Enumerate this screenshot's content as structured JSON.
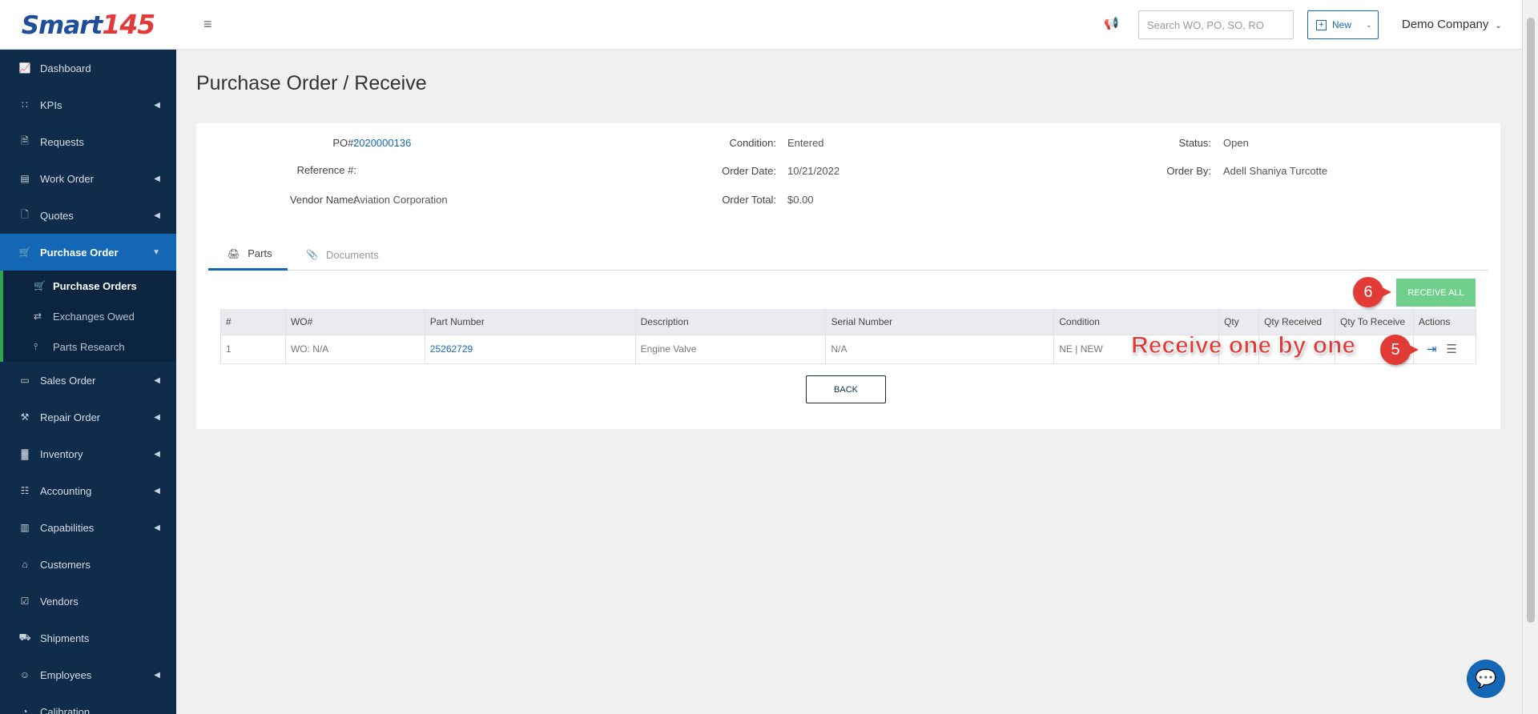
{
  "app": {
    "logo_text": "Smart",
    "logo_num": "145"
  },
  "sidebar": {
    "items": [
      {
        "label": "Dashboard",
        "icon": "chart-icon",
        "chevron": false
      },
      {
        "label": "KPIs",
        "icon": "kpi-icon",
        "chevron": true
      },
      {
        "label": "Requests",
        "icon": "document-icon",
        "chevron": false
      },
      {
        "label": "Work Order",
        "icon": "work-order-icon",
        "chevron": true
      },
      {
        "label": "Quotes",
        "icon": "quote-icon",
        "chevron": true
      },
      {
        "label": "Purchase Order",
        "icon": "cart-icon",
        "chevron": true
      },
      {
        "label": "Sales Order",
        "icon": "card-icon",
        "chevron": true
      },
      {
        "label": "Repair Order",
        "icon": "repair-icon",
        "chevron": true
      },
      {
        "label": "Inventory",
        "icon": "inventory-icon",
        "chevron": true
      },
      {
        "label": "Accounting",
        "icon": "accounting-icon",
        "chevron": true
      },
      {
        "label": "Capabilities",
        "icon": "capabilities-icon",
        "chevron": true
      },
      {
        "label": "Customers",
        "icon": "customers-icon",
        "chevron": false
      },
      {
        "label": "Vendors",
        "icon": "vendors-icon",
        "chevron": false
      },
      {
        "label": "Shipments",
        "icon": "truck-icon",
        "chevron": false
      },
      {
        "label": "Employees",
        "icon": "employees-icon",
        "chevron": true
      },
      {
        "label": "Calibration",
        "icon": "calibration-icon",
        "chevron": false
      }
    ],
    "submenu": [
      {
        "label": "Purchase Orders",
        "icon": "cart-icon"
      },
      {
        "label": "Exchanges Owed",
        "icon": "exchange-icon"
      },
      {
        "label": "Parts Research",
        "icon": "tree-icon"
      }
    ]
  },
  "topbar": {
    "search_placeholder": "Search WO, PO, SO, RO",
    "new_label": "New",
    "company": "Demo Company"
  },
  "page": {
    "title": "Purchase Order / Receive"
  },
  "info": {
    "po_label": "PO#:",
    "po_value": "2020000136",
    "ref_label": "Reference #:",
    "ref_value": "",
    "vendor_label": "Vendor Name:",
    "vendor_value": "Aviation Corporation",
    "condition_label": "Condition:",
    "condition_value": "Entered",
    "order_date_label": "Order Date:",
    "order_date_value": "10/21/2022",
    "order_total_label": "Order Total:",
    "order_total_value": "$0.00",
    "status_label": "Status:",
    "status_value": "Open",
    "order_by_label": "Order By:",
    "order_by_value": "Adell Shaniya Turcotte"
  },
  "tabs": [
    {
      "label": "Parts",
      "icon": "printer-icon"
    },
    {
      "label": "Documents",
      "icon": "paperclip-icon"
    }
  ],
  "buttons": {
    "receive_all": "RECEIVE ALL",
    "back": "BACK"
  },
  "table": {
    "headers": [
      "#",
      "WO#",
      "Part Number",
      "Description",
      "Serial Number",
      "Condition",
      "Qty",
      "Qty Received",
      "Qty To Receive",
      "Actions"
    ],
    "rows": [
      {
        "num": "1",
        "wo": "WO: N/A",
        "part_number": "25262729",
        "description": "Engine Valve",
        "serial": "N/A",
        "condition": "NE | NEW",
        "qty": "",
        "qty_received": "",
        "qty_to_receive": ""
      }
    ]
  },
  "annotations": {
    "badge_receive_all": "6",
    "badge_receive_one": "5",
    "receive_one_text": "Receive one by one"
  },
  "colors": {
    "sidebar_bg": "#0f2d4a",
    "accent": "#1467b4",
    "success": "#6fcf8b",
    "annotation": "#e23b36"
  }
}
